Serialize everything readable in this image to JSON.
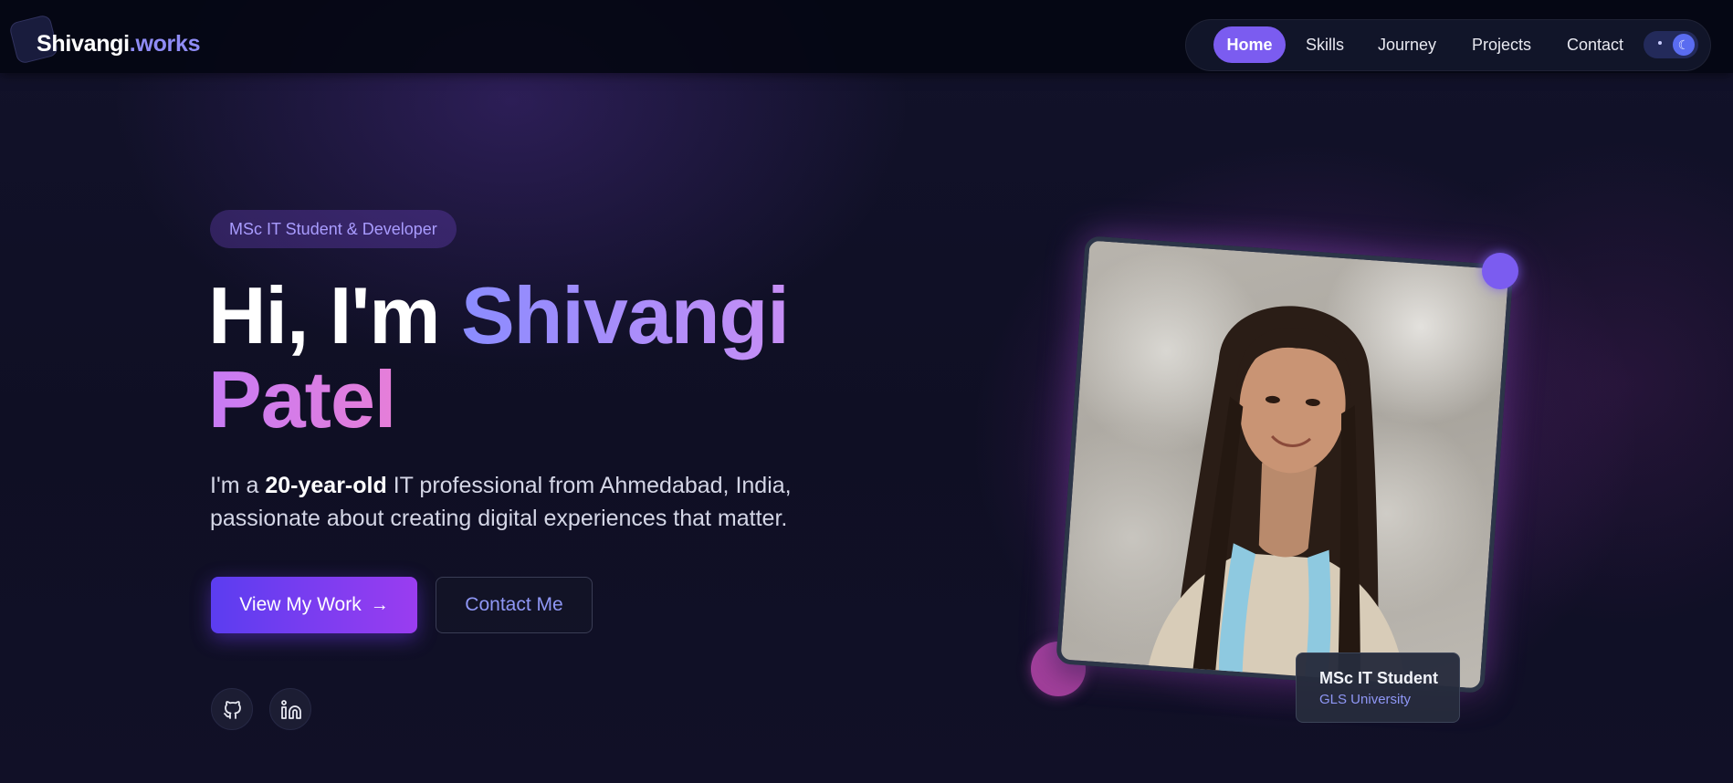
{
  "nav": {
    "logo_primary": "Shivangi",
    "logo_accent": ".works",
    "links": [
      {
        "label": "Home",
        "active": true
      },
      {
        "label": "Skills",
        "active": false
      },
      {
        "label": "Journey",
        "active": false
      },
      {
        "label": "Projects",
        "active": false
      },
      {
        "label": "Contact",
        "active": false
      }
    ],
    "theme_toggle_icon": "moon-toggle-icon"
  },
  "hero": {
    "badge": "MSc IT Student & Developer",
    "title_prefix": "Hi, I'm",
    "title_first": "Shivangi",
    "title_last": "Patel",
    "bio_pre": "I'm a",
    "bio_strong": "20-year-old",
    "bio_post": "IT professional from Ahmedabad, India, passionate about creating digital experiences that matter.",
    "primary_button": "View My Work",
    "secondary_button": "Contact Me",
    "socials": [
      {
        "name": "github-icon"
      },
      {
        "name": "linkedin-icon"
      }
    ]
  },
  "profile_card": {
    "title": "MSc IT Student",
    "subtitle": "GLS University"
  },
  "colors": {
    "accent": "#7b5cf0",
    "accent_text": "#8f97f5",
    "background": "#0f0f24"
  }
}
